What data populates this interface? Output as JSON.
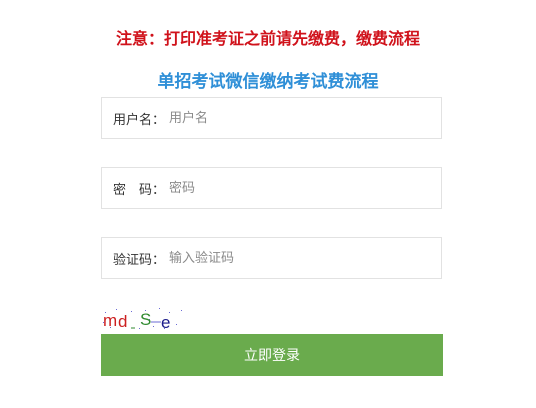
{
  "notice": {
    "text": "注意：打印准考证之前请先缴费，缴费流程"
  },
  "flow_link": {
    "text": "单招考试微信缴纳考试费流程"
  },
  "form": {
    "username": {
      "label": "用户名：",
      "placeholder": "用户名"
    },
    "password": {
      "label": "密　码：",
      "placeholder": "密码"
    },
    "captcha": {
      "label": "验证码：",
      "placeholder": "输入验证码",
      "image_text": "mdSe"
    },
    "submit_label": "立即登录"
  },
  "colors": {
    "notice": "#d0121b",
    "link": "#2f8fd7",
    "button": "#6aab4d",
    "border": "#e2e2e2"
  }
}
